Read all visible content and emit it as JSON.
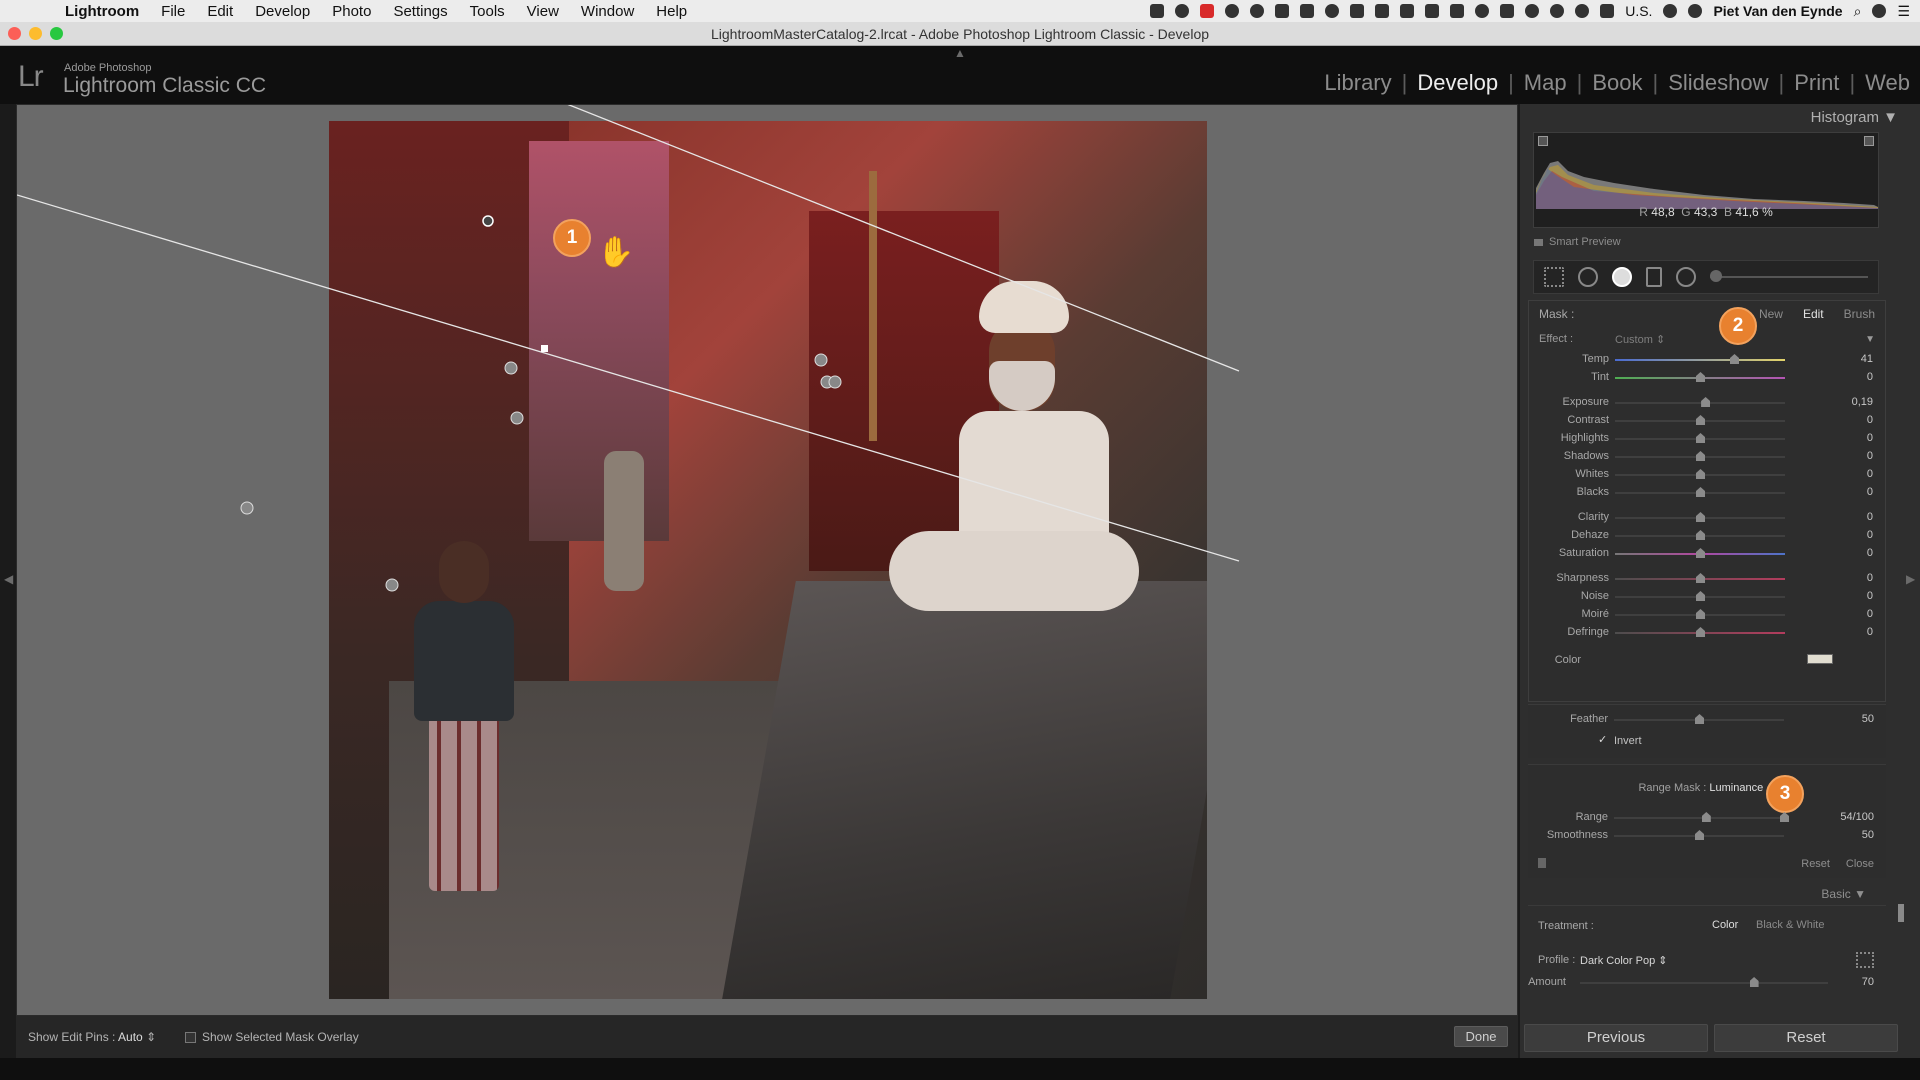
{
  "menubar": {
    "apple": "",
    "app": "Lightroom",
    "items": [
      "File",
      "Edit",
      "Develop",
      "Photo",
      "Settings",
      "Tools",
      "View",
      "Window",
      "Help"
    ],
    "input_source": "U.S.",
    "user": "Piet Van den Eynde"
  },
  "window": {
    "title": "LightroomMasterCatalog-2.lrcat - Adobe Photoshop Lightroom Classic - Develop"
  },
  "identity": {
    "logo": "Lr",
    "brand_small": "Adobe Photoshop",
    "brand_large": "Lightroom Classic CC"
  },
  "modules": [
    "Library",
    "Develop",
    "Map",
    "Book",
    "Slideshow",
    "Print",
    "Web"
  ],
  "active_module": "Develop",
  "callouts": {
    "one": "1",
    "two": "2",
    "three": "3"
  },
  "toolbar": {
    "pins_label": "Show Edit Pins :",
    "pins_value": "Auto",
    "overlay_label": "Show Selected Mask Overlay",
    "done": "Done"
  },
  "histogram": {
    "header": "Histogram",
    "r_label": "R",
    "r": "48,8",
    "g_label": "G",
    "g": "43,3",
    "b_label": "B",
    "b": "41,6",
    "unit": "%",
    "smart_preview": "Smart Preview"
  },
  "mask": {
    "label": "Mask :",
    "new": "New",
    "edit": "Edit",
    "brush": "Brush",
    "effect_label": "Effect :",
    "effect_value": "Custom"
  },
  "sliders": {
    "group1": [
      {
        "label": "Temp",
        "value": "41",
        "pos": 0.7
      },
      {
        "label": "Tint",
        "value": "0",
        "pos": 0.5
      }
    ],
    "group2": [
      {
        "label": "Exposure",
        "value": "0,19",
        "pos": 0.53
      },
      {
        "label": "Contrast",
        "value": "0",
        "pos": 0.5
      },
      {
        "label": "Highlights",
        "value": "0",
        "pos": 0.5
      },
      {
        "label": "Shadows",
        "value": "0",
        "pos": 0.5
      },
      {
        "label": "Whites",
        "value": "0",
        "pos": 0.5
      },
      {
        "label": "Blacks",
        "value": "0",
        "pos": 0.5
      }
    ],
    "group3": [
      {
        "label": "Clarity",
        "value": "0",
        "pos": 0.5
      },
      {
        "label": "Dehaze",
        "value": "0",
        "pos": 0.5
      },
      {
        "label": "Saturation",
        "value": "0",
        "pos": 0.5
      }
    ],
    "group4": [
      {
        "label": "Sharpness",
        "value": "0",
        "pos": 0.5
      },
      {
        "label": "Noise",
        "value": "0",
        "pos": 0.5
      },
      {
        "label": "Moiré",
        "value": "0",
        "pos": 0.5
      },
      {
        "label": "Defringe",
        "value": "0",
        "pos": 0.5
      }
    ]
  },
  "color": {
    "label": "Color",
    "swatch": "#e1ddd0"
  },
  "feather": {
    "label": "Feather",
    "value": "50",
    "pos": 0.5
  },
  "invert": {
    "label": "Invert",
    "checked": true
  },
  "range_mask": {
    "label": "Range Mask :",
    "value": "Luminance",
    "range_label": "Range",
    "range_value": "54/100",
    "range_low": 0.54,
    "range_high": 1.0,
    "smoothness_label": "Smoothness",
    "smoothness_value": "50",
    "smoothness_pos": 0.5,
    "reset": "Reset",
    "close": "Close"
  },
  "basic": {
    "header": "Basic",
    "treatment_label": "Treatment :",
    "color": "Color",
    "bw": "Black & White",
    "profile_label": "Profile :",
    "profile_value": "Dark Color Pop",
    "amount_label": "Amount",
    "amount_value": "70",
    "amount_pos": 0.7
  },
  "buttons": {
    "previous": "Previous",
    "reset": "Reset"
  },
  "colors": {
    "accent_callout": "#e8812f",
    "mask_overlay": "#b02a22"
  }
}
